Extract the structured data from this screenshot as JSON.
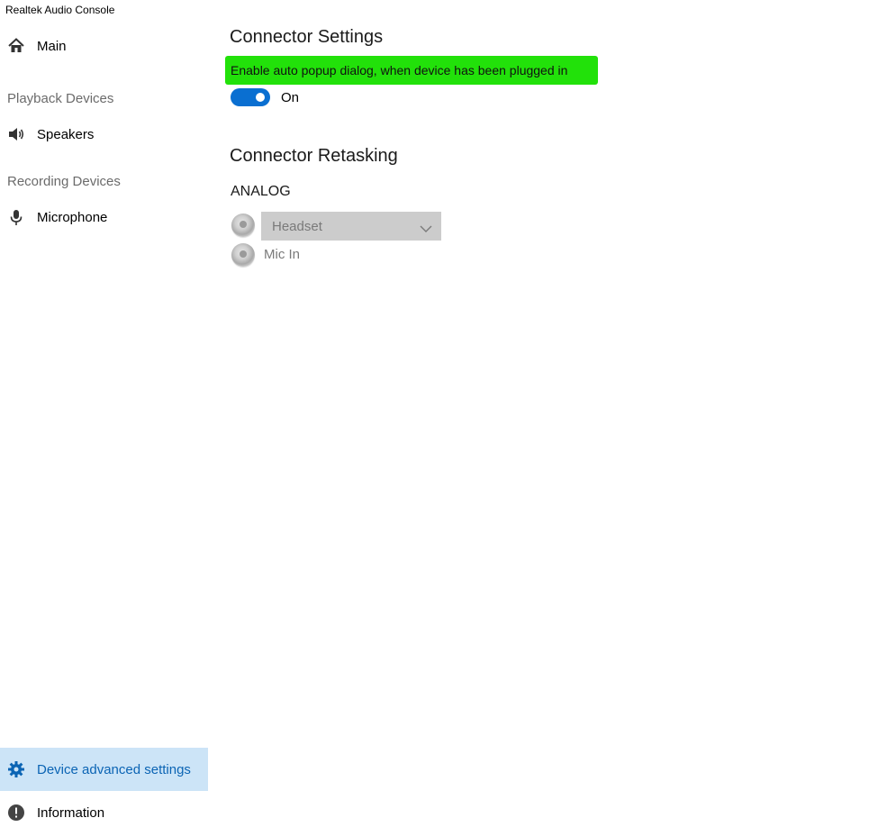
{
  "window": {
    "title": "Realtek Audio Console"
  },
  "sidebar": {
    "main": {
      "label": "Main",
      "icon": "home-icon"
    },
    "playback_header": "Playback Devices",
    "speakers": {
      "label": "Speakers",
      "icon": "speaker-icon"
    },
    "recording_header": "Recording Devices",
    "microphone": {
      "label": "Microphone",
      "icon": "microphone-icon"
    },
    "device_advanced": {
      "label": "Device advanced settings",
      "icon": "gear-icon",
      "selected": true
    },
    "information": {
      "label": "Information",
      "icon": "info-icon"
    }
  },
  "connector_settings": {
    "title": "Connector Settings",
    "option_text": "Enable auto popup dialog, when device has been plugged in",
    "toggle_state": "On"
  },
  "connector_retasking": {
    "title": "Connector Retasking",
    "group_label": "ANALOG",
    "jack1": {
      "selected_value": "Headset"
    },
    "jack2": {
      "label": "Mic In"
    }
  },
  "colors": {
    "accent": "#0a6fd1",
    "selected_background": "#cce4f7",
    "highlight": "#22e10a",
    "disabled_select": "#cccccc"
  }
}
